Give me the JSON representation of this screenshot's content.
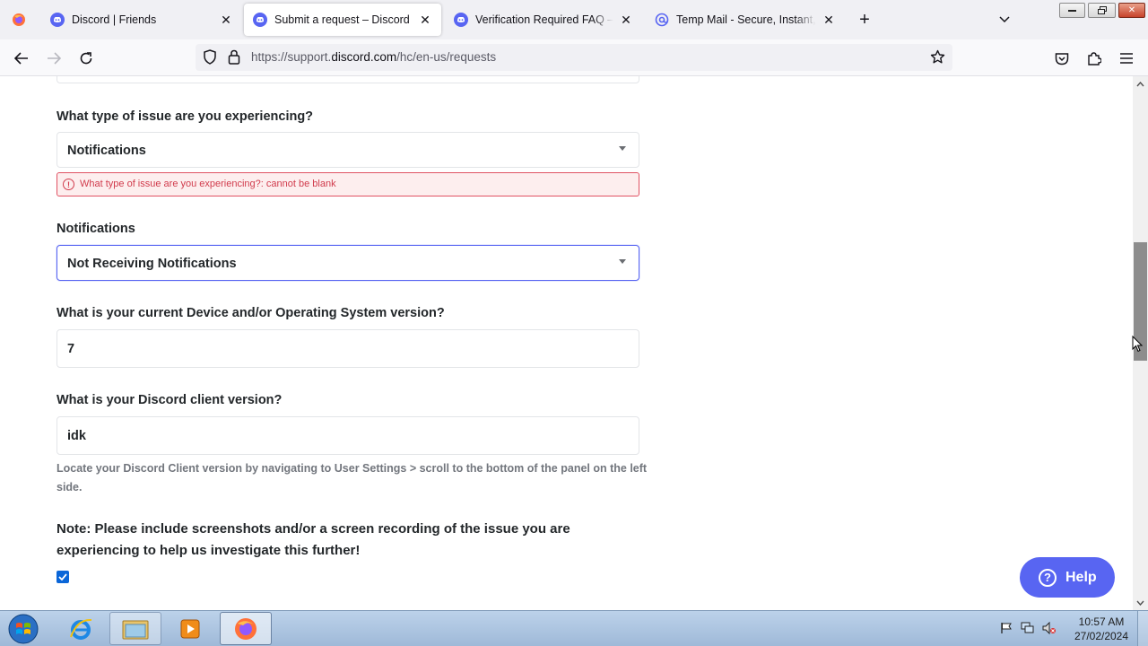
{
  "browser": {
    "tabs": [
      {
        "title": "Discord | Friends",
        "favicon": "discord-icon",
        "active": false
      },
      {
        "title": "Submit a request – Discord",
        "favicon": "discord-icon",
        "active": true
      },
      {
        "title": "Verification Required FAQ – Discord",
        "favicon": "discord-icon",
        "active": false
      },
      {
        "title": "Temp Mail - Secure, Instant, Fast",
        "favicon": "at-sign-icon",
        "active": false
      }
    ],
    "url_prefix": "https://support.",
    "url_domain": "discord.com",
    "url_path": "/hc/en-us/requests"
  },
  "form": {
    "issue_type": {
      "label": "What type of issue are you experiencing?",
      "value": "Notifications",
      "error": "What type of issue are you experiencing?: cannot be blank"
    },
    "notifications": {
      "label": "Notifications",
      "value": "Not Receiving Notifications"
    },
    "device": {
      "label": "What is your current Device and/or Operating System version?",
      "value": "7"
    },
    "client_version": {
      "label": "What is your Discord client version?",
      "value": "idk",
      "hint": "Locate your Discord Client version by navigating to User Settings > scroll to the bottom of the panel on the left side."
    },
    "note": "Note: Please include screenshots and/or a screen recording of the issue you are experiencing to help us investigate this further!",
    "note_checked": true
  },
  "help_button": {
    "label": "Help"
  },
  "taskbar": {
    "time": "10:57 AM",
    "date": "27/02/2024"
  },
  "colors": {
    "discord_blurple": "#5865f2",
    "error_red": "#d13b4c",
    "checkbox_blue": "#0a66d8"
  }
}
